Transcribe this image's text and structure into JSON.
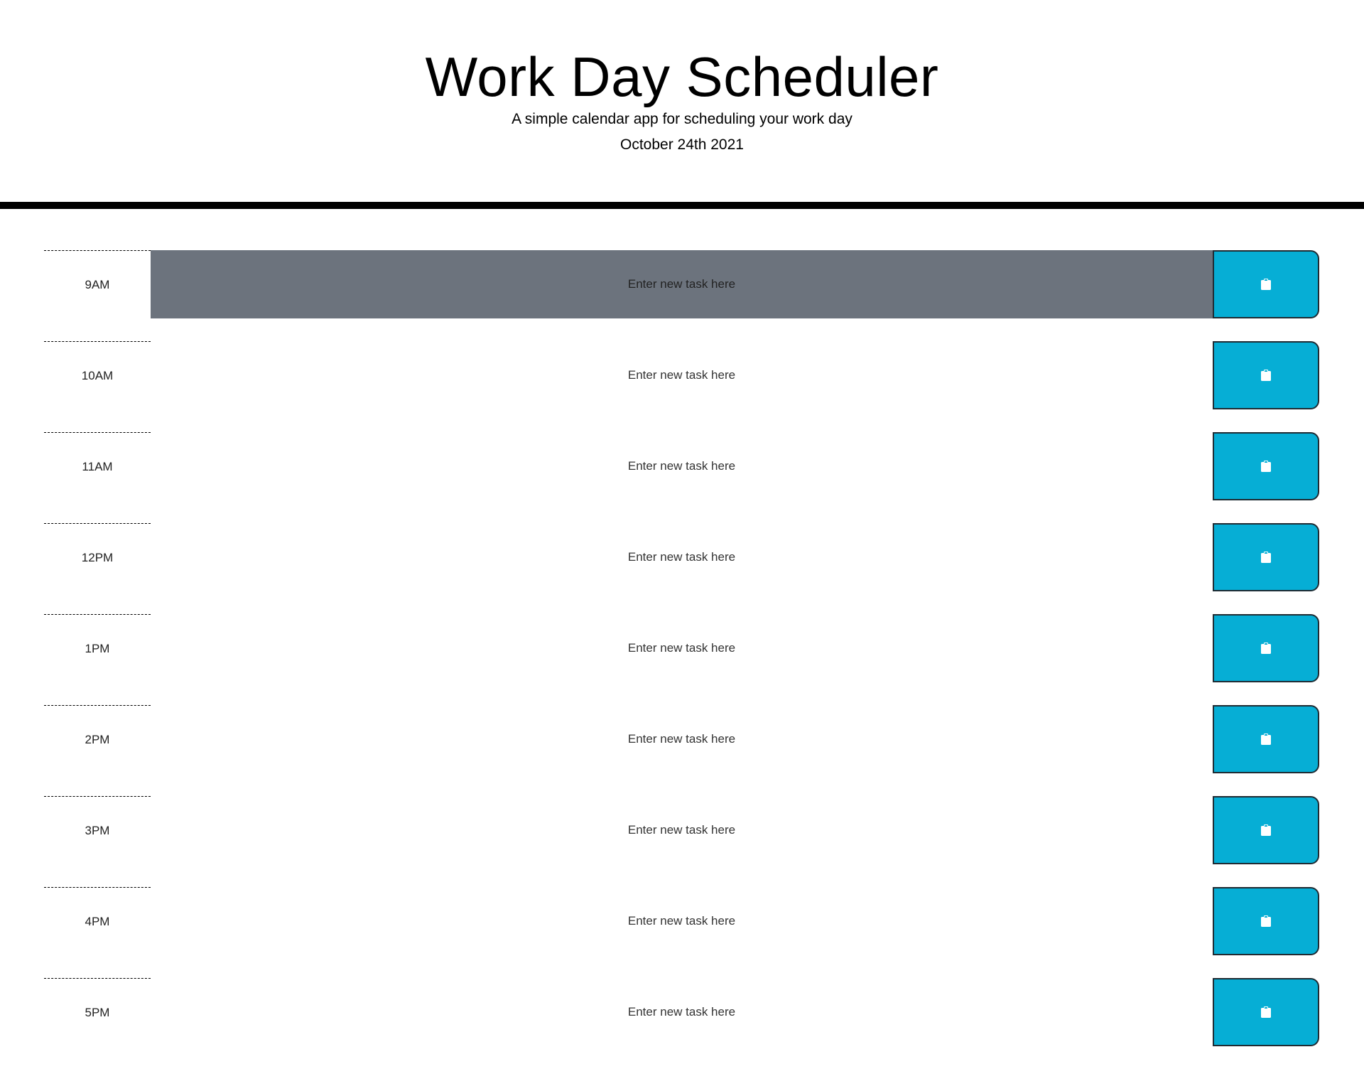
{
  "header": {
    "title": "Work Day Scheduler",
    "subtitle": "A simple calendar app for scheduling your work day",
    "current_day": "October 24th 2021"
  },
  "colors": {
    "past": "#6c737d",
    "save_button": "#06aed5",
    "divider": "#000000"
  },
  "rows": [
    {
      "hour": "9AM",
      "placeholder": "Enter new task here",
      "state": "past",
      "save_icon": "clipboard-icon"
    },
    {
      "hour": "10AM",
      "placeholder": "Enter new task here",
      "state": "future",
      "save_icon": "clipboard-icon"
    },
    {
      "hour": "11AM",
      "placeholder": "Enter new task here",
      "state": "future",
      "save_icon": "clipboard-icon"
    },
    {
      "hour": "12PM",
      "placeholder": "Enter new task here",
      "state": "future",
      "save_icon": "clipboard-icon"
    },
    {
      "hour": "1PM",
      "placeholder": "Enter new task here",
      "state": "future",
      "save_icon": "clipboard-icon"
    },
    {
      "hour": "2PM",
      "placeholder": "Enter new task here",
      "state": "future",
      "save_icon": "clipboard-icon"
    },
    {
      "hour": "3PM",
      "placeholder": "Enter new task here",
      "state": "future",
      "save_icon": "clipboard-icon"
    },
    {
      "hour": "4PM",
      "placeholder": "Enter new task here",
      "state": "future",
      "save_icon": "clipboard-icon"
    },
    {
      "hour": "5PM",
      "placeholder": "Enter new task here",
      "state": "future",
      "save_icon": "clipboard-icon"
    }
  ]
}
